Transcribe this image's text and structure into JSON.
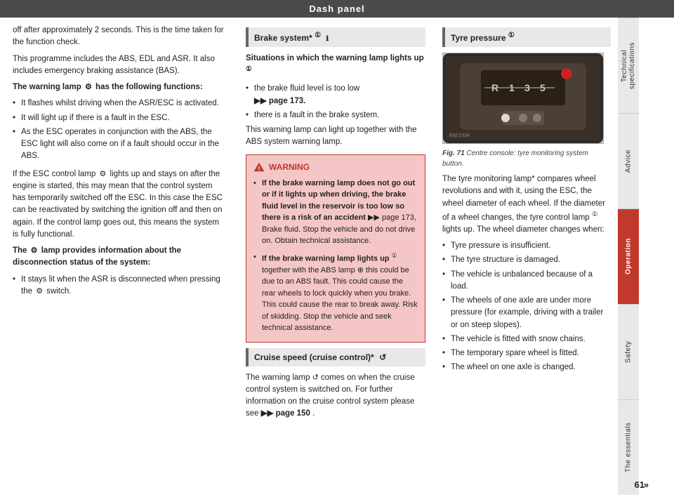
{
  "header": {
    "title": "Dash panel"
  },
  "left_col": {
    "intro_p1": "off after approximately 2 seconds. This is the time taken for the function check.",
    "intro_p2": "This programme includes the ABS, EDL and ASR. It also includes emergency braking assistance (BAS).",
    "warning_lamp_heading": "The warning lamp",
    "warning_lamp_icon": "⚠",
    "warning_lamp_heading2": "has the following functions:",
    "bullet1": "It flashes whilst driving when the ASR/ESC is activated.",
    "bullet2": "It will light up if there is a fault in the ESC.",
    "bullet3": "As the ESC operates in conjunction with the ABS, the ESC light will also come on if a fault should occur in the ABS.",
    "control_lamp_text": "If the ESC control lamp",
    "control_lamp_icon": "⚙",
    "control_lamp_text2": "lights up and stays on after the engine is started, this may mean that the control system has temporarily switched off the ESC. In this case the ESC can be reactivated by switching the ignition off and then on again. If the control lamp goes out, this means the system is fully functional.",
    "lamp_info_heading": "The",
    "lamp_info_icon": "⚙",
    "lamp_info_heading2": "lamp provides information about the disconnection status of the system:",
    "lamp_info_bullet": "It stays lit when the ASR is disconnected when pressing the",
    "lamp_info_icon2": "⚙",
    "lamp_info_bullet2": "switch."
  },
  "middle_col": {
    "brake_section_title": "Brake system*",
    "brake_icon": "①",
    "situations_heading": "Situations in which the warning lamp lights up",
    "situations_icon": "①",
    "bullet_brake_fluid": "the brake fluid level is too low",
    "bullet_brake_ref": "▶▶ page 173.",
    "bullet_brake_fault": "there is a fault in the brake system.",
    "together_text": "This warning lamp can light up together with the ABS system warning lamp.",
    "warning_header": "WARNING",
    "warning_bullet1_bold": "If the brake warning lamp does not go out or if it lights up when driving, the brake fluid level in the reservoir is too low so there is a risk of an accident",
    "warning_bullet1_ref": "▶▶ page 173,",
    "warning_bullet1_end": "Brake fluid. Stop the vehicle and do not drive on. Obtain technical assistance.",
    "warning_bullet2_bold": "If the brake warning lamp lights up",
    "warning_bullet2_icon": "①",
    "warning_bullet2_text": "together with the ABS lamp",
    "warning_bullet2_icon2": "⊕",
    "warning_bullet2_end": "this could be due to an ABS fault. This could cause the rear wheels to lock quickly when you brake. This could cause the rear to break away. Risk of skidding. Stop the vehicle and seek technical assistance.",
    "cruise_section_title": "Cruise speed (cruise control)*",
    "cruise_icon": "↺",
    "cruise_text": "The warning lamp",
    "cruise_icon2": "↺",
    "cruise_text2": "comes on when the cruise control system is switched on. For further information on the cruise control system please see",
    "cruise_ref": "▶▶ page 150",
    "cruise_end": "."
  },
  "right_col": {
    "tyre_section_title": "Tyre pressure",
    "tyre_icon": "①",
    "fig_label": "Fig. 71",
    "fig_caption": "Centre console: tyre monitoring system button.",
    "tyre_text1": "The tyre monitoring lamp* compares wheel revolutions and with it, using the ESC, the wheel diameter of each wheel. If the diameter of a wheel changes, the tyre control lamp",
    "tyre_icon2": "①",
    "tyre_text2": "lights up. The wheel diameter changes when:",
    "bullet_tyre1": "Tyre pressure is insufficient.",
    "bullet_tyre2": "The tyre structure is damaged.",
    "bullet_tyre3": "The vehicle is unbalanced because of a load.",
    "bullet_tyre4": "The wheels of one axle are under more pressure (for example, driving with a trailer or on steep slopes).",
    "bullet_tyre5": "The vehicle is fitted with snow chains.",
    "bullet_tyre6": "The temporary spare wheel is fitted.",
    "bullet_tyre7": "The wheel on one axle is changed.",
    "double_arrow": "»"
  },
  "sidebar": {
    "tabs": [
      {
        "label": "Technical specifications",
        "active": false
      },
      {
        "label": "Advice",
        "active": false
      },
      {
        "label": "Operation",
        "active": true
      },
      {
        "label": "Safety",
        "active": false
      },
      {
        "label": "The essentials",
        "active": false
      }
    ]
  },
  "page": {
    "number": "61"
  }
}
